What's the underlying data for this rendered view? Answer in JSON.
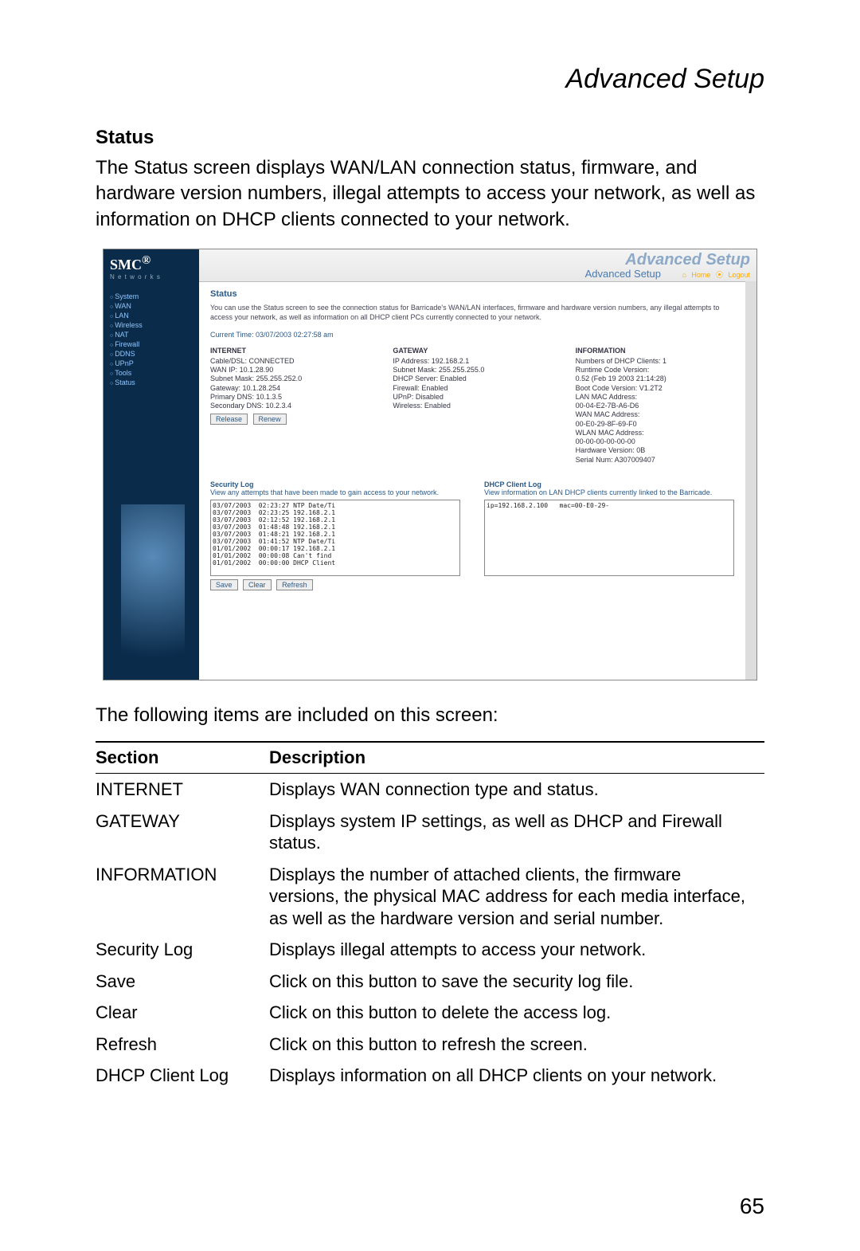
{
  "header": {
    "title": "Advanced Setup"
  },
  "section": {
    "heading": "Status"
  },
  "intro": "The Status screen displays WAN/LAN connection status, firmware, and hardware version numbers, illegal attempts to access your network, as well as information on DHCP clients connected to your network.",
  "after_screenshot": "The following items are included on this screen:",
  "pageNumber": "65",
  "table": {
    "headers": {
      "section": "Section",
      "description": "Description"
    },
    "rows": [
      {
        "section": "INTERNET",
        "description": "Displays WAN connection type and status."
      },
      {
        "section": "GATEWAY",
        "description": "Displays system IP settings, as well as DHCP and Firewall status."
      },
      {
        "section": "INFORMATION",
        "description": "Displays the number of attached clients, the firmware versions, the physical MAC address for each media interface, as well as the hardware version and serial number."
      },
      {
        "section": "Security Log",
        "description": "Displays illegal attempts to access your network."
      },
      {
        "section": "Save",
        "description": "Click on this button to save the security log file."
      },
      {
        "section": "Clear",
        "description": "Click on this button to delete the access log."
      },
      {
        "section": "Refresh",
        "description": "Click on this button to refresh the screen."
      },
      {
        "section": "DHCP Client Log",
        "description": "Displays information on all DHCP clients on your network."
      }
    ]
  },
  "screenshot": {
    "logo": "SMC",
    "logoReg": "®",
    "logoSub": "N e t w o r k s",
    "advanced_fade": "Advanced Setup",
    "advanced_small": "Advanced Setup",
    "home": "Home",
    "logout": "Logout",
    "nav": [
      "System",
      "WAN",
      "LAN",
      "Wireless",
      "NAT",
      "Firewall",
      "DDNS",
      "UPnP",
      "Tools",
      "Status"
    ],
    "status_title": "Status",
    "status_desc": "You can use the Status screen to see the connection status for Barricade's WAN/LAN interfaces, firmware and hardware version numbers, any illegal attempts to access your network, as well as information on all DHCP client PCs currently connected to your network.",
    "current_time": "Current Time: 03/07/2003 02:27:58 am",
    "internet": {
      "h": "INTERNET",
      "l1": "Cable/DSL:  CONNECTED",
      "l2": "WAN IP:  10.1.28.90",
      "l3": "Subnet Mask:  255.255.252.0",
      "l4": "Gateway:  10.1.28.254",
      "l5": "Primary DNS:  10.1.3.5",
      "l6": "Secondary DNS:  10.2.3.4",
      "release": "Release",
      "renew": "Renew"
    },
    "gateway": {
      "h": "GATEWAY",
      "l1": "IP Address:  192.168.2.1",
      "l2": "Subnet Mask:  255.255.255.0",
      "l3": "DHCP Server:  Enabled",
      "l4": "Firewall:  Enabled",
      "l5": "UPnP:  Disabled",
      "l6": "Wireless:  Enabled"
    },
    "information": {
      "h": "INFORMATION",
      "l1": "Numbers of DHCP Clients:  1",
      "l2": "Runtime Code Version:",
      "l3": "  0.52 (Feb 19 2003 21:14:28)",
      "l4": "Boot Code Version:  V1.2T2",
      "l5": "LAN MAC Address:",
      "l6": "  00-04-E2-7B-A6-D6",
      "l7": "WAN MAC Address:",
      "l8": "  00-E0-29-8F-69-F0",
      "l9": "WLAN MAC Address:",
      "l10": "  00-00-00-00-00-00",
      "l11": "Hardware Version:  0B",
      "l12": "Serial Num:  A307009407"
    },
    "seclog": {
      "h": "Security Log",
      "d": "View any attempts that have been made to gain access to your network.",
      "rows": [
        "03/07/2003  02:23:27 NTP Date/Ti",
        "03/07/2003  02:23:25 192.168.2.1",
        "03/07/2003  02:12:52 192.168.2.1",
        "03/07/2003  01:48:48 192.168.2.1",
        "03/07/2003  01:48:21 192.168.2.1",
        "03/07/2003  01:41:52 NTP Date/Ti",
        "01/01/2002  00:00:17 192.168.2.1",
        "01/01/2002  00:00:08 Can't find",
        "01/01/2002  00:00:00 DHCP Client"
      ],
      "save": "Save",
      "clear": "Clear",
      "refresh": "Refresh"
    },
    "dhcplog": {
      "h": "DHCP Client Log",
      "d": "View information on LAN DHCP clients currently linked to the Barricade.",
      "row1": "ip=192.168.2.100   mac=00-E0-29-"
    }
  }
}
